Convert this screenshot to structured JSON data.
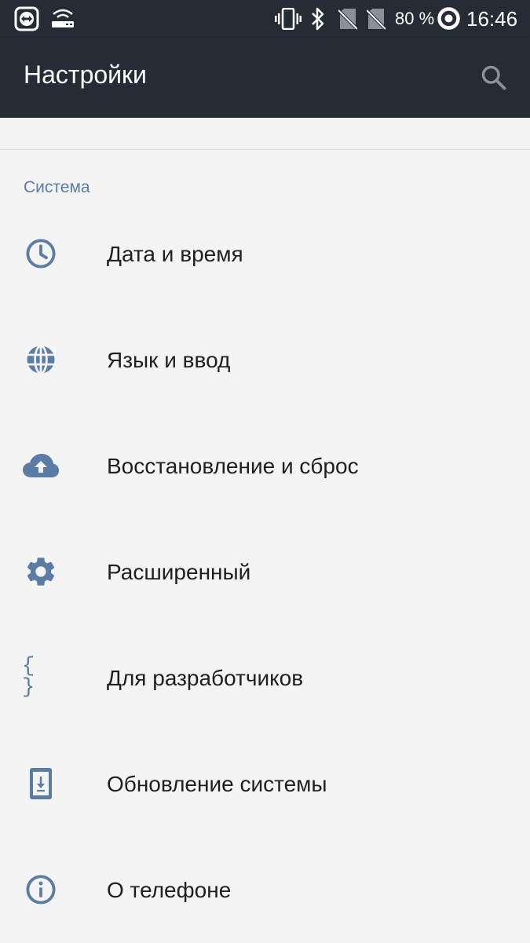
{
  "status_bar": {
    "battery_percent": "80 %",
    "time": "16:46",
    "icons": [
      "teamviewer-icon",
      "wifi-router-icon",
      "vibrate-icon",
      "bluetooth-icon",
      "no-sim-icon",
      "no-sim-icon",
      "battery-ring-icon"
    ]
  },
  "app_bar": {
    "title": "Настройки",
    "search_icon": "search-icon",
    "background": "#252c36"
  },
  "section": {
    "header": "Система",
    "accent_color": "#5b7da5"
  },
  "items": [
    {
      "label": "Дата и время",
      "icon": "clock-icon"
    },
    {
      "label": "Язык и ввод",
      "icon": "globe-icon"
    },
    {
      "label": "Восстановление и сброс",
      "icon": "cloud-upload-icon"
    },
    {
      "label": "Расширенный",
      "icon": "gear-icon"
    },
    {
      "label": "Для разработчиков",
      "icon": "braces-icon",
      "glyph": "{ }"
    },
    {
      "label": "Обновление системы",
      "icon": "system-update-icon"
    },
    {
      "label": "О телефоне",
      "icon": "info-icon"
    }
  ]
}
